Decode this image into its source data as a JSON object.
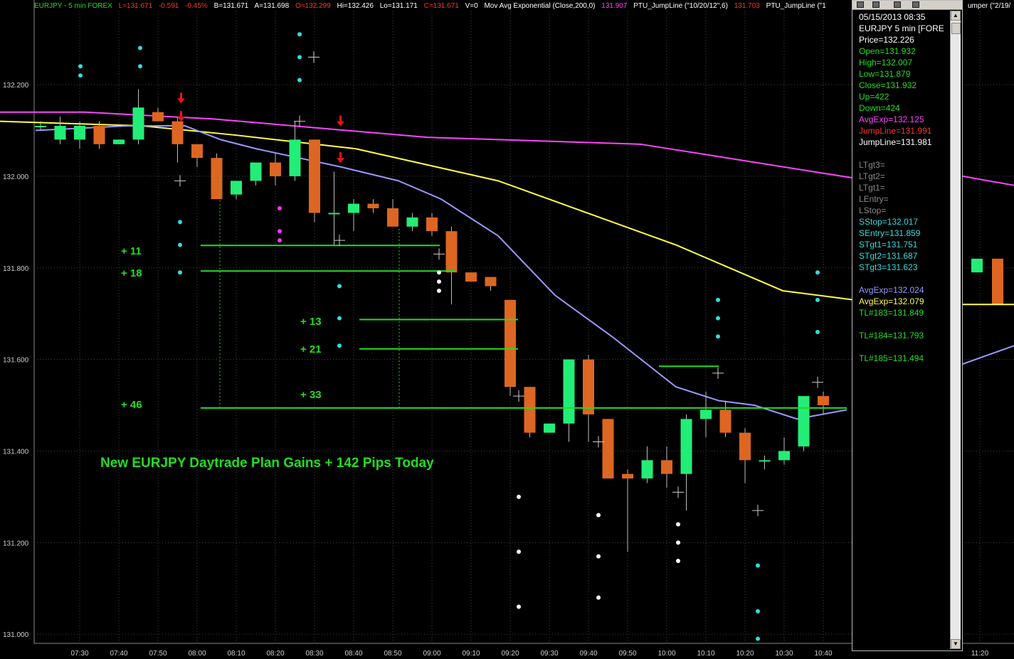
{
  "header": {
    "symbol": "EURJPY - 5 min  FOREX",
    "last": "L=131.671",
    "change": "-0.591",
    "change_pct": "-0.45%",
    "bid": "B=131.671",
    "ask": "A=131.698",
    "open": "O=132.299",
    "high": "Hi=132.426",
    "low": "Lo=131.171",
    "close": "C=131.671",
    "volume": "V=0",
    "ma_label": "Mov Avg Exponential (Close,200,0)",
    "ma_value": "131.907",
    "jump_label": "PTU_JumpLine (\"10/20/12\",6)",
    "jump_value": "131.703",
    "jump2_label": "PTU_JumpLine (\"1",
    "right_fragment": "umper (\"2/19/"
  },
  "chart_data": {
    "type": "candlestick",
    "ylim": [
      130.98,
      132.36
    ],
    "yticks": [
      "132.200",
      "132.000",
      "131.800",
      "131.600",
      "131.400",
      "131.200",
      "131.000"
    ],
    "xticks": [
      "07:30",
      "07:40",
      "07:50",
      "08:00",
      "08:10",
      "08:20",
      "08:30",
      "08:40",
      "08:50",
      "09:00",
      "09:10",
      "09:20",
      "09:30",
      "09:40",
      "09:50",
      "10:00",
      "10:10",
      "10:20",
      "10:30",
      "10:40",
      "11:20"
    ],
    "grid": true,
    "candles": [
      {
        "t": "07:20",
        "o": 132.11,
        "h": 132.12,
        "l": 132.1,
        "c": 132.11
      },
      {
        "t": "07:25",
        "o": 132.08,
        "h": 132.13,
        "l": 132.07,
        "c": 132.11
      },
      {
        "t": "07:30",
        "o": 132.08,
        "h": 132.12,
        "l": 132.06,
        "c": 132.11
      },
      {
        "t": "07:35",
        "o": 132.11,
        "h": 132.12,
        "l": 132.06,
        "c": 132.07
      },
      {
        "t": "07:40",
        "o": 132.07,
        "h": 132.08,
        "l": 132.07,
        "c": 132.08
      },
      {
        "t": "07:45",
        "o": 132.08,
        "h": 132.19,
        "l": 132.07,
        "c": 132.15
      },
      {
        "t": "07:50",
        "o": 132.14,
        "h": 132.15,
        "l": 132.12,
        "c": 132.12
      },
      {
        "t": "07:55",
        "o": 132.12,
        "h": 132.13,
        "l": 132.03,
        "c": 132.07
      },
      {
        "t": "08:00",
        "o": 132.07,
        "h": 132.07,
        "l": 132.02,
        "c": 132.04
      },
      {
        "t": "08:05",
        "o": 132.04,
        "h": 132.05,
        "l": 131.95,
        "c": 131.95
      },
      {
        "t": "08:10",
        "o": 131.96,
        "h": 131.98,
        "l": 131.95,
        "c": 131.99
      },
      {
        "t": "08:15",
        "o": 131.99,
        "h": 132.02,
        "l": 131.98,
        "c": 132.03
      },
      {
        "t": "08:20",
        "o": 132.03,
        "h": 132.05,
        "l": 131.98,
        "c": 132.0
      },
      {
        "t": "08:25",
        "o": 132.0,
        "h": 132.12,
        "l": 131.99,
        "c": 132.08
      },
      {
        "t": "08:30",
        "o": 132.08,
        "h": 132.08,
        "l": 131.9,
        "c": 131.92
      },
      {
        "t": "08:35",
        "o": 131.92,
        "h": 132.01,
        "l": 131.85,
        "c": 131.92
      },
      {
        "t": "08:40",
        "o": 131.92,
        "h": 131.95,
        "l": 131.88,
        "c": 131.94
      },
      {
        "t": "08:45",
        "o": 131.94,
        "h": 131.95,
        "l": 131.92,
        "c": 131.93
      },
      {
        "t": "08:50",
        "o": 131.93,
        "h": 131.95,
        "l": 131.89,
        "c": 131.89
      },
      {
        "t": "08:55",
        "o": 131.89,
        "h": 131.92,
        "l": 131.88,
        "c": 131.91
      },
      {
        "t": "09:00",
        "o": 131.91,
        "h": 131.92,
        "l": 131.87,
        "c": 131.88
      },
      {
        "t": "09:05",
        "o": 131.88,
        "h": 131.89,
        "l": 131.72,
        "c": 131.79
      },
      {
        "t": "09:10",
        "o": 131.79,
        "h": 131.79,
        "l": 131.77,
        "c": 131.77
      },
      {
        "t": "09:15",
        "o": 131.78,
        "h": 131.78,
        "l": 131.75,
        "c": 131.76
      },
      {
        "t": "09:20",
        "o": 131.73,
        "h": 131.73,
        "l": 131.52,
        "c": 131.54
      },
      {
        "t": "09:25",
        "o": 131.54,
        "h": 131.54,
        "l": 131.43,
        "c": 131.44
      },
      {
        "t": "09:30",
        "o": 131.44,
        "h": 131.46,
        "l": 131.44,
        "c": 131.46
      },
      {
        "t": "09:35",
        "o": 131.46,
        "h": 131.6,
        "l": 131.42,
        "c": 131.6
      },
      {
        "t": "09:40",
        "o": 131.6,
        "h": 131.61,
        "l": 131.42,
        "c": 131.48
      },
      {
        "t": "09:45",
        "o": 131.47,
        "h": 131.47,
        "l": 131.34,
        "c": 131.34
      },
      {
        "t": "09:50",
        "o": 131.35,
        "h": 131.36,
        "l": 131.18,
        "c": 131.34
      },
      {
        "t": "09:55",
        "o": 131.34,
        "h": 131.41,
        "l": 131.33,
        "c": 131.38
      },
      {
        "t": "10:00",
        "o": 131.38,
        "h": 131.41,
        "l": 131.32,
        "c": 131.35
      },
      {
        "t": "10:05",
        "o": 131.35,
        "h": 131.48,
        "l": 131.27,
        "c": 131.47
      },
      {
        "t": "10:10",
        "o": 131.47,
        "h": 131.53,
        "l": 131.43,
        "c": 131.49
      },
      {
        "t": "10:15",
        "o": 131.49,
        "h": 131.51,
        "l": 131.43,
        "c": 131.44
      },
      {
        "t": "10:20",
        "o": 131.44,
        "h": 131.45,
        "l": 131.33,
        "c": 131.38
      },
      {
        "t": "10:25",
        "o": 131.38,
        "h": 131.39,
        "l": 131.36,
        "c": 131.38
      },
      {
        "t": "10:30",
        "o": 131.38,
        "h": 131.43,
        "l": 131.37,
        "c": 131.4
      },
      {
        "t": "10:35",
        "o": 131.41,
        "h": 131.52,
        "l": 131.4,
        "c": 131.52
      },
      {
        "t": "10:40",
        "o": 131.52,
        "h": 131.53,
        "l": 131.48,
        "c": 131.5
      }
    ],
    "series": [
      {
        "color": "#ff44ff",
        "values": [
          [
            0,
            132.14
          ],
          [
            120,
            132.14
          ],
          [
            300,
            132.125
          ],
          [
            600,
            132.085
          ],
          [
            900,
            132.07
          ],
          [
            1200,
            131.996
          ]
        ]
      },
      {
        "color": "#ffff44",
        "values": [
          [
            0,
            132.12
          ],
          [
            200,
            132.11
          ],
          [
            330,
            132.09
          ],
          [
            500,
            132.06
          ],
          [
            700,
            131.99
          ],
          [
            950,
            131.85
          ],
          [
            1100,
            131.75
          ],
          [
            1200,
            131.73
          ]
        ]
      },
      {
        "color": "#9999ff",
        "values": [
          [
            50,
            132.1
          ],
          [
            180,
            132.11
          ],
          [
            260,
            132.11
          ],
          [
            310,
            132.08
          ],
          [
            360,
            132.06
          ],
          [
            480,
            132.02
          ],
          [
            560,
            131.99
          ],
          [
            620,
            131.95
          ],
          [
            700,
            131.87
          ],
          [
            780,
            131.74
          ],
          [
            860,
            131.65
          ],
          [
            950,
            131.54
          ],
          [
            1010,
            131.51
          ],
          [
            1060,
            131.5
          ],
          [
            1120,
            131.47
          ],
          [
            1190,
            131.49
          ]
        ]
      }
    ],
    "annotations": [
      "+ 11",
      "+ 18",
      "+ 13",
      "+ 21",
      "+ 46",
      "+ 33"
    ],
    "title": "New EURJPY Daytrade Plan Gains + 142 Pips Today"
  },
  "data_window": {
    "rows": [
      {
        "text": "05/15/2013 08:35",
        "color": "#ffffff"
      },
      {
        "text": "EURJPY 5 min [FORE",
        "color": "#ffffff"
      },
      {
        "text": "Price=132.226",
        "color": "#ffffff"
      },
      {
        "text": "Open=131.932",
        "color": "#22dd22"
      },
      {
        "text": "High=132.007",
        "color": "#22dd22"
      },
      {
        "text": "Low=131.879",
        "color": "#22dd22"
      },
      {
        "text": "Close=131.932",
        "color": "#22dd22"
      },
      {
        "text": "Up=422",
        "color": "#22dd22"
      },
      {
        "text": "Down=424",
        "color": "#22dd22"
      },
      {
        "text": "AvgExp=132.125",
        "color": "#ff44ff"
      },
      {
        "text": "JumpLine=131.991",
        "color": "#ff3333"
      },
      {
        "text": "JumpLine=131.981",
        "color": "#ffffff"
      },
      {
        "text": "",
        "color": "#000000"
      },
      {
        "text": "LTgt3=",
        "color": "#888888"
      },
      {
        "text": "LTgt2=",
        "color": "#888888"
      },
      {
        "text": "LTgt1=",
        "color": "#888888"
      },
      {
        "text": "LEntry=",
        "color": "#888888"
      },
      {
        "text": "LStop=",
        "color": "#888888"
      },
      {
        "text": "SStop=132.017",
        "color": "#33dddd"
      },
      {
        "text": "SEntry=131.859",
        "color": "#33dddd"
      },
      {
        "text": "STgt1=131.751",
        "color": "#33dddd"
      },
      {
        "text": "STgt2=131.687",
        "color": "#33dddd"
      },
      {
        "text": "STgt3=131.623",
        "color": "#33dddd"
      },
      {
        "text": "",
        "color": "#000000"
      },
      {
        "text": "AvgExp=132.024",
        "color": "#9999ff"
      },
      {
        "text": "AvgExp=132.079",
        "color": "#ffff44"
      },
      {
        "text": "TL#183=131.849",
        "color": "#22dd22"
      },
      {
        "text": "",
        "color": "#000000"
      },
      {
        "text": "TL#184=131.793",
        "color": "#22dd22"
      },
      {
        "text": "",
        "color": "#000000"
      },
      {
        "text": "TL#185=131.494",
        "color": "#22dd22"
      }
    ]
  },
  "colors": {
    "up": "#22ee77",
    "down": "#dd6622",
    "grid": "#444444",
    "axis_text": "#cccccc"
  }
}
